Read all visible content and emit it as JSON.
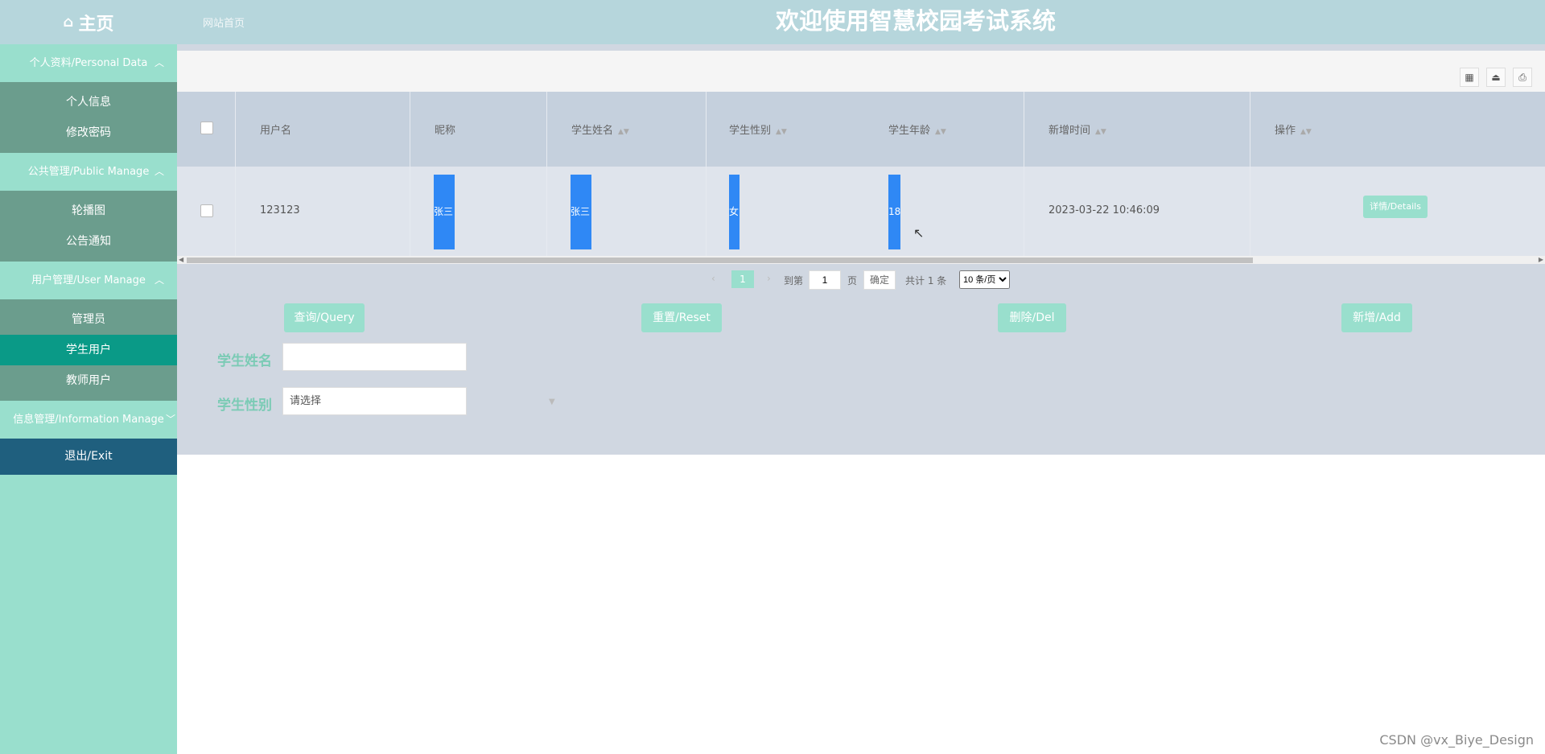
{
  "header": {
    "home_label": "主页",
    "site_link": "网站首页",
    "title": "欢迎使用智慧校园考试系统"
  },
  "sidebar": {
    "groups": [
      {
        "label": "个人资料/Personal Data",
        "items": [
          "个人信息",
          "修改密码"
        ]
      },
      {
        "label": "公共管理/Public Manage",
        "items": [
          "轮播图",
          "公告通知"
        ]
      },
      {
        "label": "用户管理/User Manage",
        "items": [
          "管理员",
          "学生用户",
          "教师用户"
        ]
      },
      {
        "label": "信息管理/Information Manage"
      }
    ],
    "active_item": "学生用户",
    "exit_label": "退出/Exit"
  },
  "table": {
    "headers": [
      "用户名",
      "昵称",
      "学生姓名",
      "学生性别",
      "学生年龄",
      "新增时间",
      "操作"
    ],
    "rows": [
      {
        "username": "123123",
        "nickname": "张三",
        "student_name": "张三",
        "gender": "女",
        "age": "18",
        "created": "2023-03-22 10:46:09",
        "action": "详情/Details"
      }
    ]
  },
  "pagination": {
    "current_page": "1",
    "goto_label": "到第",
    "goto_value": "1",
    "page_unit": "页",
    "confirm": "确定",
    "total": "共计 1 条",
    "page_size": "10 条/页"
  },
  "actions": {
    "query": "查询/Query",
    "reset": "重置/Reset",
    "del": "删除/Del",
    "add": "新增/Add"
  },
  "filters": {
    "name_label": "学生姓名",
    "name_value": "",
    "gender_label": "学生性别",
    "gender_placeholder": "请选择"
  },
  "watermark": "CSDN @vx_Biye_Design",
  "colors": {
    "accent": "#99dfcd",
    "active_menu": "#0a9a87",
    "exit": "#1f5f7e",
    "highlight": "#2f88f5"
  }
}
